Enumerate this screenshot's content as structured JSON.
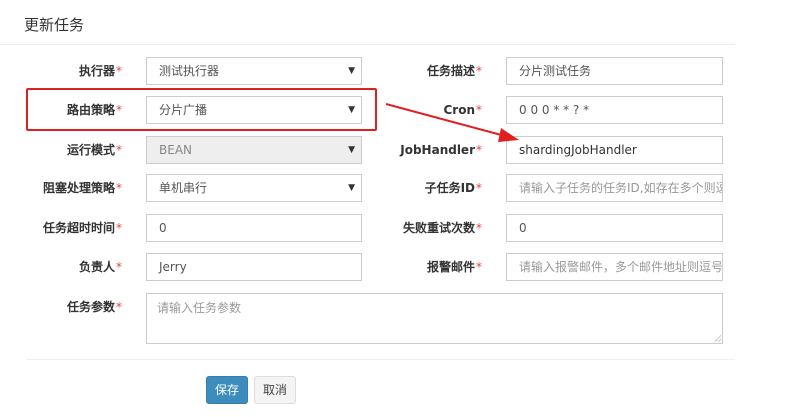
{
  "page": {
    "title": "更新任务"
  },
  "form": {
    "executor": {
      "label": "执行器",
      "value": "测试执行器"
    },
    "route_strategy": {
      "label": "路由策略",
      "value": "分片广播"
    },
    "run_mode": {
      "label": "运行模式",
      "value": "BEAN"
    },
    "block_strategy": {
      "label": "阻塞处理策略",
      "value": "单机串行"
    },
    "timeout": {
      "label": "任务超时时间",
      "value": "0"
    },
    "owner": {
      "label": "负责人",
      "value": "Jerry"
    },
    "params": {
      "label": "任务参数",
      "placeholder": "请输入任务参数"
    },
    "desc": {
      "label": "任务描述",
      "value": "分片测试任务"
    },
    "cron": {
      "label": "Cron",
      "value": "0 0 0 * * ? *"
    },
    "job_handler": {
      "label": "JobHandler",
      "value": "shardingJobHandler"
    },
    "child_job": {
      "label": "子任务ID",
      "placeholder": "请输入子任务的任务ID,如存在多个则逗号分隔"
    },
    "retry": {
      "label": "失败重试次数",
      "value": "0"
    },
    "alarm_email": {
      "label": "报警邮件",
      "placeholder": "请输入报警邮件，多个邮件地址则逗号分隔"
    }
  },
  "buttons": {
    "save": "保存",
    "cancel": "取消"
  },
  "colors": {
    "annotation": "#e02020",
    "primary": "#3c8dbc",
    "required": "#dd4b39"
  }
}
